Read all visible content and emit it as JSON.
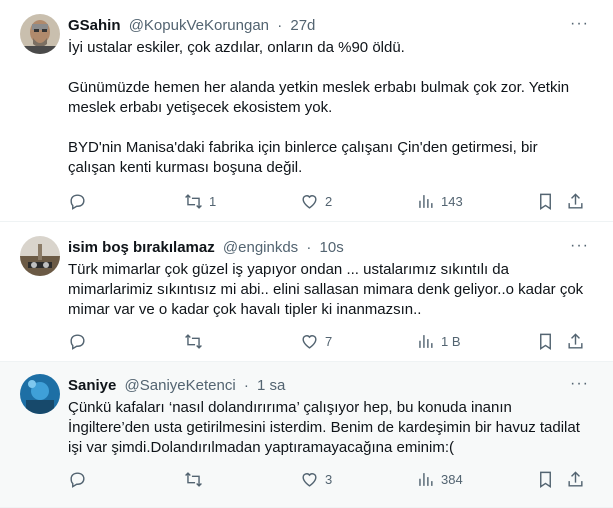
{
  "tweets": [
    {
      "name": "GSahin",
      "handle": "@KopukVeKorungan",
      "sep": "·",
      "time": "27d",
      "paragraphs": [
        "İyi ustalar eskiler, çok azdılar, onların da %90 öldü.",
        "Günümüzde hemen her alanda yetkin meslek erbabı bulmak çok zor. Yetkin meslek erbabı yetişecek ekosistem yok.",
        "BYD'nin Manisa'daki fabrika için binlerce çalışanı Çin'den getirmesi, bir çalışan kenti kurması boşuna değil."
      ],
      "replies": "",
      "retweets": "1",
      "likes": "2",
      "views": "143"
    },
    {
      "name": "isim boş bırakılamaz",
      "handle": "@enginkds",
      "sep": "·",
      "time": "10s",
      "paragraphs": [
        "Türk mimarlar çok güzel iş yapıyor ondan ... ustalarımız sıkıntılı da mimarlarimiz sıkıntısız mi abi.. elini sallasan mimara denk geliyor..o kadar çok mimar var ve o kadar çok havalı tipler ki inanmazsın.."
      ],
      "replies": "",
      "retweets": "",
      "likes": "7",
      "views": "1 B"
    },
    {
      "name": "Saniye",
      "handle": "@SaniyeKetenci",
      "sep": "·",
      "time": "1 sa",
      "paragraphs": [
        "Çünkü kafaları ‘nasıl dolandırırıma’ çalışıyor hep, bu konuda inanın İngiltere’den usta getirilmesini isterdim. Benim de kardeşimin bir havuz tadilat işi var şimdi.Dolandırılmadan yaptıramayacağına eminim:("
      ],
      "replies": "",
      "retweets": "",
      "likes": "3",
      "views": "384"
    }
  ],
  "more_glyph": "···",
  "colors": {
    "text": "#0f1419",
    "muted": "#536471",
    "border": "#eff3f4",
    "highlight_bg": "#f7f9f9"
  }
}
